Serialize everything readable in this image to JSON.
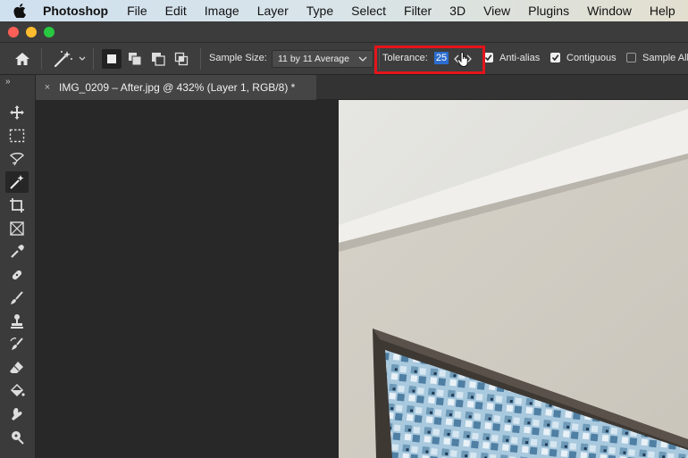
{
  "menubar": {
    "apple_icon": "apple-logo-icon",
    "app_name": "Photoshop",
    "items": [
      "File",
      "Edit",
      "Image",
      "Layer",
      "Type",
      "Select",
      "Filter",
      "3D",
      "View",
      "Plugins",
      "Window",
      "Help"
    ]
  },
  "window": {
    "traffic_lights": [
      "close",
      "minimize",
      "zoom"
    ]
  },
  "options_bar": {
    "home_icon": "home-icon",
    "tool_icon": "magic-wand-icon",
    "selection_modes": [
      "new-selection",
      "add-to-selection",
      "subtract-from-selection",
      "intersect-with-selection"
    ],
    "sample_size_label": "Sample Size:",
    "sample_size_value": "11 by 11 Average",
    "tolerance_label": "Tolerance:",
    "tolerance_value": "25",
    "anti_alias_label": "Anti-alias",
    "anti_alias_checked": true,
    "contiguous_label": "Contiguous",
    "contiguous_checked": true,
    "sample_all_label": "Sample All",
    "sample_all_checked": false,
    "highlight_color": "#e5141b"
  },
  "tools": [
    "move-tool",
    "rectangular-marquee-tool",
    "lasso-tool",
    "magic-wand-tool",
    "crop-tool",
    "frame-tool",
    "eyedropper-tool",
    "spot-healing-brush-tool",
    "brush-tool",
    "clone-stamp-tool",
    "history-brush-tool",
    "eraser-tool",
    "paint-bucket-tool",
    "smudge-tool",
    "dodge-tool"
  ],
  "document_tab": {
    "close_label": "×",
    "title": "IMG_0209 – After.jpg @ 432% (Layer 1, RGB/8) *"
  },
  "colors": {
    "accent": "#2c6ccf",
    "panel": "#3d3d3d",
    "canvas": "#282828"
  }
}
